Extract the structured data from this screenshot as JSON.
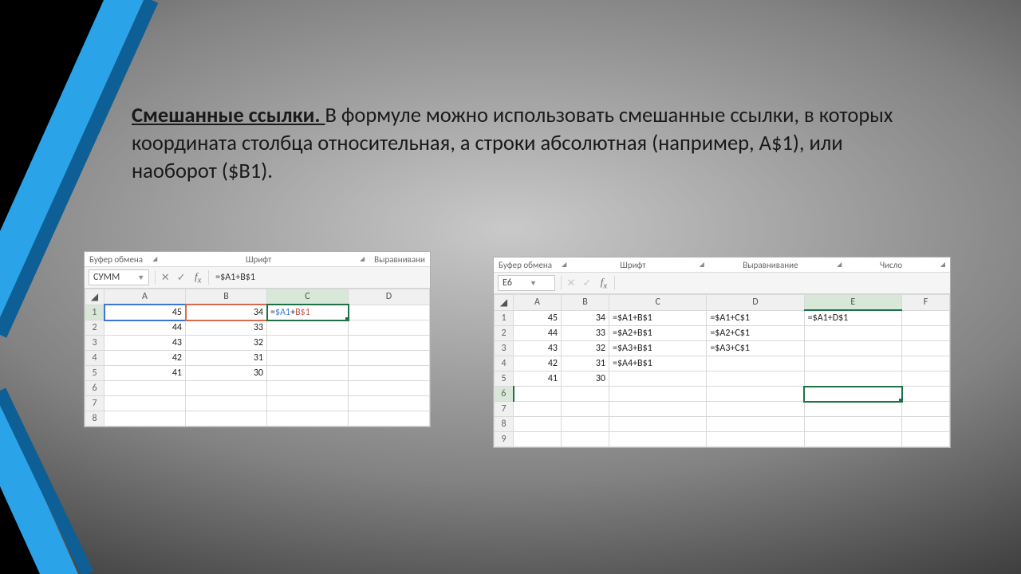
{
  "heading": "Смешанные ссылки. ",
  "body": "В формуле можно использовать смешанные ссылки, в которых координата столбца относительная, а строки абсолютная (например, А$1), или наоборот ($В1).",
  "shot1": {
    "groups": {
      "clipboard": "Буфер обмена",
      "font": "Шрифт",
      "align": "Выравнивани"
    },
    "namebox": "СУММ",
    "formula": "=$A1+B$1",
    "tok_a": "$A1",
    "tok_b": "B$1",
    "cols": [
      "A",
      "B",
      "C",
      "D"
    ],
    "rows": [
      {
        "n": "1",
        "a": "45",
        "b": "34",
        "c": "=$A1+B$1"
      },
      {
        "n": "2",
        "a": "44",
        "b": "33",
        "c": ""
      },
      {
        "n": "3",
        "a": "43",
        "b": "32",
        "c": ""
      },
      {
        "n": "4",
        "a": "42",
        "b": "31",
        "c": ""
      },
      {
        "n": "5",
        "a": "41",
        "b": "30",
        "c": ""
      },
      {
        "n": "6",
        "a": "",
        "b": "",
        "c": ""
      },
      {
        "n": "7",
        "a": "",
        "b": "",
        "c": ""
      },
      {
        "n": "8",
        "a": "",
        "b": "",
        "c": ""
      }
    ]
  },
  "shot2": {
    "groups": {
      "clipboard": "Буфер обмена",
      "font": "Шрифт",
      "align": "Выравнивание",
      "number": "Число"
    },
    "namebox": "E6",
    "cols": [
      "A",
      "B",
      "C",
      "D",
      "E",
      "F"
    ],
    "rows": [
      {
        "n": "1",
        "a": "45",
        "b": "34",
        "c": "=$A1+B$1",
        "d": "=$A1+C$1",
        "e": "=$A1+D$1"
      },
      {
        "n": "2",
        "a": "44",
        "b": "33",
        "c": "=$A2+B$1",
        "d": "=$A2+C$1",
        "e": ""
      },
      {
        "n": "3",
        "a": "43",
        "b": "32",
        "c": "=$A3+B$1",
        "d": "=$A3+C$1",
        "e": ""
      },
      {
        "n": "4",
        "a": "42",
        "b": "31",
        "c": "=$A4+B$1",
        "d": "",
        "e": ""
      },
      {
        "n": "5",
        "a": "41",
        "b": "30",
        "c": "",
        "d": "",
        "e": ""
      },
      {
        "n": "6",
        "a": "",
        "b": "",
        "c": "",
        "d": "",
        "e": ""
      },
      {
        "n": "7",
        "a": "",
        "b": "",
        "c": "",
        "d": "",
        "e": ""
      },
      {
        "n": "8",
        "a": "",
        "b": "",
        "c": "",
        "d": "",
        "e": ""
      },
      {
        "n": "9",
        "a": "",
        "b": "",
        "c": "",
        "d": "",
        "e": ""
      }
    ]
  }
}
